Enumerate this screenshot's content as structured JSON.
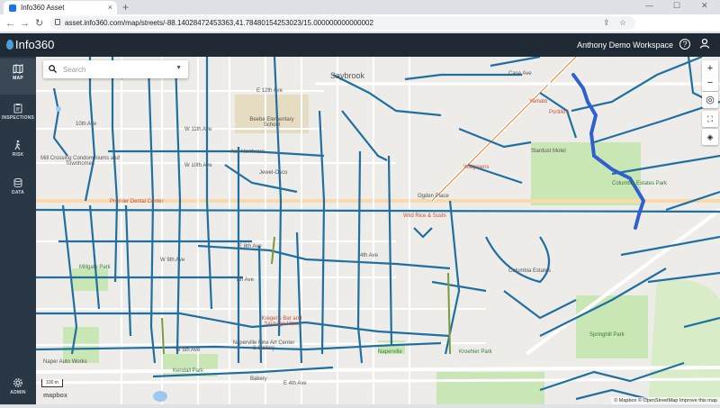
{
  "browser": {
    "tab_title": "Info360 Asset",
    "tab_close": "×",
    "new_tab": "+",
    "url": "asset.info360.com/map/streets/-88.14028472453363,41.78480154253023/15.000000000000002",
    "back": "←",
    "forward": "→",
    "reload": "↻",
    "share_icon": "⇪",
    "bookmark_icon": "☆",
    "minimize": "—",
    "maximize": "☐",
    "close": "✕"
  },
  "header": {
    "logo_text": "Info360",
    "workspace": "Anthony Demo Workspace",
    "help_icon": "?",
    "user_icon": "user-icon"
  },
  "sidebar": {
    "items": [
      {
        "label": "MAP",
        "icon": "map-icon"
      },
      {
        "label": "INSPECTIONS",
        "icon": "clipboard-icon"
      },
      {
        "label": "RISK",
        "icon": "walk-icon"
      },
      {
        "label": "DATA",
        "icon": "database-icon"
      },
      {
        "label": "ADMIN",
        "icon": "gear-icon"
      }
    ]
  },
  "search": {
    "placeholder": "Search"
  },
  "map_controls": {
    "zoom_in": "+",
    "zoom_out": "−",
    "locate": "◎",
    "fullscreen": "⛶",
    "layers": "◈"
  },
  "map_labels": {
    "city": "Saybrook",
    "streets": [
      "E 12th Ave",
      "W 11th Ave",
      "W 10th Ave",
      "E 8th Ave",
      "W 9th Ave",
      "7th Ave",
      "W 5th Ave",
      "E 4th Ave",
      "4th Ave",
      "10th Ave",
      "Case Ave",
      "Ogden Place",
      "Seagrass",
      "Columbia Estates",
      "N Washington St"
    ],
    "pois": [
      "Mill Street Elementary School",
      "Beebe Elementary School",
      "Mill Crossing Condominiums and Townhomes",
      "Ace Hardware",
      "Jewel-Osco",
      "Premier Dental Center",
      "Wild Rice & Sushi",
      "Walgreens",
      "Stardust Motel",
      "Yamato",
      "Portillo's",
      "Kreger's Bar and Sausage Haus",
      "Naperville Fine Art Center & Gallery",
      "Kendall Park",
      "Millgate Park",
      "Seager Park",
      "Springhill Park",
      "Columbia Estates Park",
      "Kroehler Park",
      "Naperville",
      "Bakery",
      "Naper Auto Works"
    ]
  },
  "scale": "100 m",
  "mapbox_logo": "mapbox",
  "attribution": "© Mapbox © OpenStreetMap  Improve this map",
  "colors": {
    "header": "#1f2a35",
    "sidebar": "#2a3744",
    "pipe": "#1f6fa0",
    "highlight": "#2f5fd0",
    "park": "#c9e6b5"
  }
}
